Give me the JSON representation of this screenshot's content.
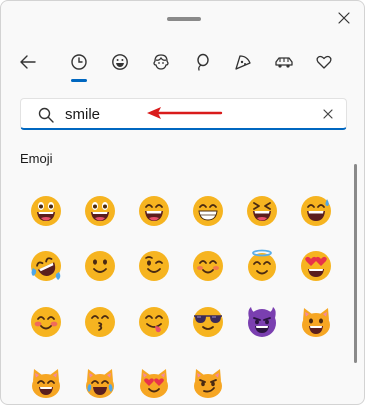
{
  "icons": {
    "close": "close-icon",
    "back": "back-arrow-icon",
    "recent": "clock-icon",
    "smileys": "smiley-icon",
    "people": "person-face-icon",
    "celebration": "balloon-icon",
    "food": "pizza-icon",
    "travel": "car-icon",
    "symbols": "heart-icon",
    "search": "search-icon",
    "clear": "clear-icon"
  },
  "colors": {
    "accent": "#0067c0",
    "face": "#f6b420",
    "annotation_arrow": "#d91b1b"
  },
  "search": {
    "value": "smile"
  },
  "section": {
    "title": "Emoji"
  },
  "emojis": [
    "grinning-face-big-eyes",
    "grinning-face-big-eyes-alt",
    "grinning-face-smiling-eyes",
    "beaming-face",
    "grinning-squinting-face",
    "grinning-face-sweat",
    "rolling-on-floor-laughing",
    "slightly-smiling-face",
    "winking-face",
    "smiling-face-smiling-eyes",
    "smiling-face-halo",
    "smiling-face-heart-eyes",
    "smiling-face",
    "kissing-face-smiling-eyes",
    "face-savoring-food",
    "smiling-face-sunglasses",
    "smiling-face-horns",
    "grinning-cat",
    "grinning-cat-smiling-eyes",
    "cat-tears-of-joy",
    "smiling-cat-heart-eyes",
    "cat-wry-smile"
  ]
}
